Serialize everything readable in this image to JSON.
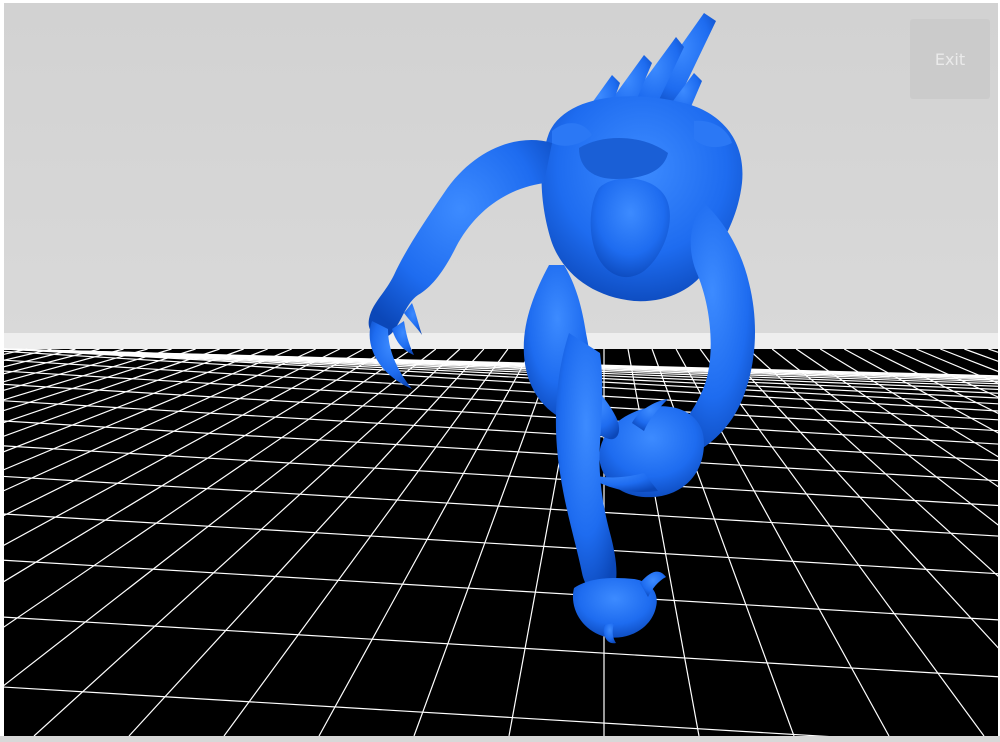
{
  "viewer": {
    "exit_label": "Exit",
    "model_name": "blue-creature-model",
    "model_color": "#1e6cf0",
    "sky_color": "#d4d4d4",
    "floor_color": "#000000",
    "grid_color": "#ffffff"
  }
}
